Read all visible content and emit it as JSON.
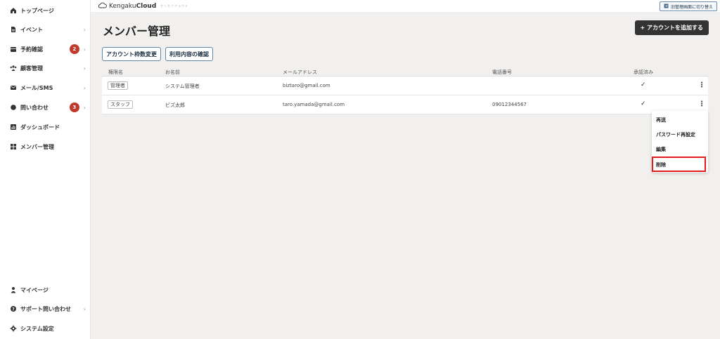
{
  "sidebar": {
    "items": [
      {
        "label": "トップページ",
        "icon": "home-icon",
        "chevron": ""
      },
      {
        "label": "イベント",
        "icon": "document-icon",
        "chevron": "›"
      },
      {
        "label": "予約確認",
        "icon": "calendar-icon",
        "badge": "2",
        "chevron": "›"
      },
      {
        "label": "顧客管理",
        "icon": "users-icon",
        "chevron": "›"
      },
      {
        "label": "メール/SMS",
        "icon": "mail-icon",
        "chevron": "›"
      },
      {
        "label": "問い合わせ",
        "icon": "chat-icon",
        "badge": "3",
        "chevron": "›"
      },
      {
        "label": "ダッシュボード",
        "icon": "chart-icon",
        "chevron": ""
      },
      {
        "label": "メンバー管理",
        "icon": "grid-icon",
        "chevron": ""
      }
    ],
    "bottom_items": [
      {
        "label": "マイページ",
        "icon": "person-icon",
        "chevron": ""
      },
      {
        "label": "サポート問い合わせ",
        "icon": "help-icon",
        "chevron": "›"
      },
      {
        "label": "システム設定",
        "icon": "gear-icon",
        "chevron": ""
      }
    ]
  },
  "header": {
    "logo_prefix": "Kengaku",
    "logo_bold": "Cloud",
    "logo_tag": "ケンガククラウド",
    "switch_button": "旧管理画面に切り替え"
  },
  "main": {
    "title": "メンバー管理",
    "add_button": "+ アカウントを追加する",
    "quota_button": "アカウント枠数変更",
    "usage_button": "利用内容の確認",
    "table": {
      "headers": [
        "権限名",
        "お名前",
        "メールアドレス",
        "電話番号",
        "承認済み"
      ],
      "rows": [
        {
          "role": "管理者",
          "name": "システム管理者",
          "email": "biztaro@gmail.com",
          "phone": "",
          "approved": "✓"
        },
        {
          "role": "スタッフ",
          "name": "ビズ太郎",
          "email": "taro.yamada@gmail.com",
          "phone": "09012344567",
          "approved": "✓"
        }
      ]
    },
    "context_menu": [
      "再送",
      "パスワード再設定",
      "編集",
      "削除"
    ],
    "highlight_color": "#e21b1b"
  }
}
